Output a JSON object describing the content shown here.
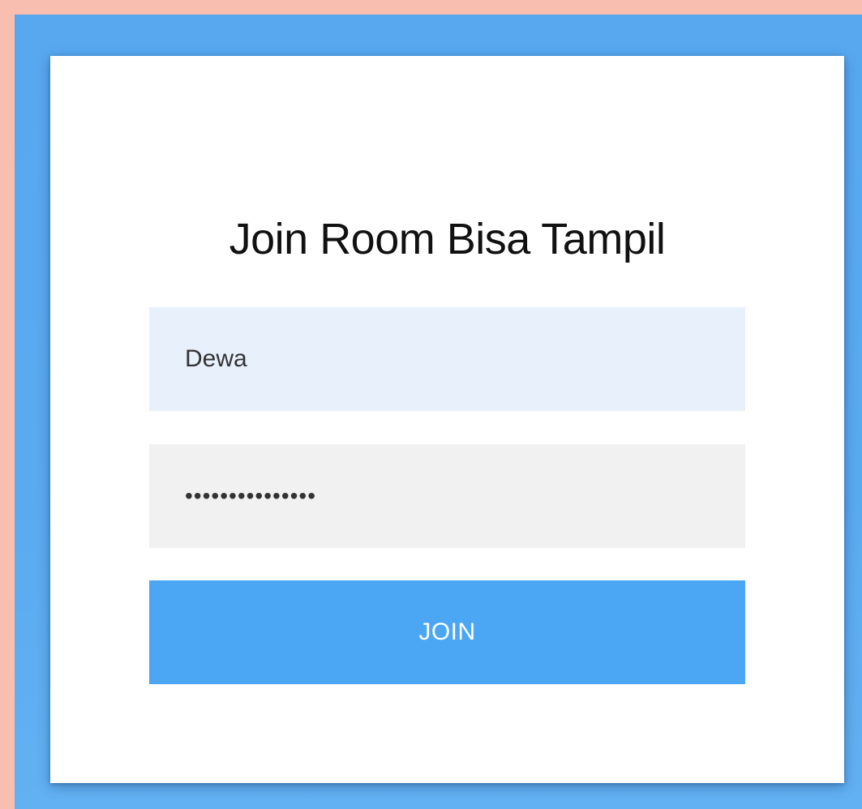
{
  "form": {
    "title": "Join Room Bisa Tampil",
    "name_value": "Dewa",
    "password_value": "•••••••••••••••",
    "join_label": "JOIN"
  },
  "colors": {
    "outer_background": "#F8BEB0",
    "panel_background": "#5AAAF0",
    "card_background": "#FFFFFF",
    "name_field_background": "#E8F0FC",
    "password_field_background": "#F1F1F1",
    "join_button_background": "#4BA6F3",
    "join_button_text": "#FFFFFF"
  }
}
